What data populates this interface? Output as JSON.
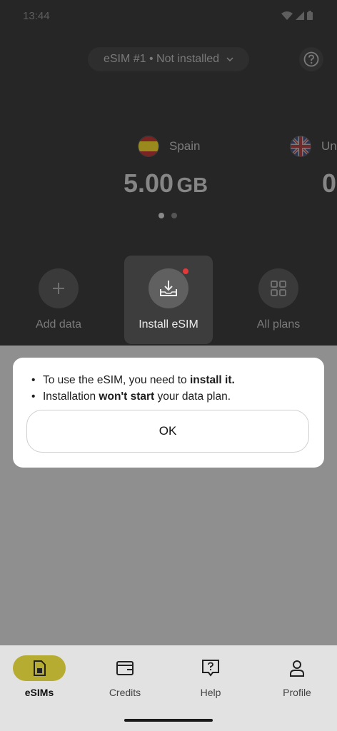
{
  "status": {
    "time": "13:44"
  },
  "header": {
    "selector_label": "eSIM #1 • Not installed",
    "help_icon": "question-circle-icon"
  },
  "carousel": {
    "cards": [
      {
        "country": "Spain",
        "data_value": "5.00",
        "data_unit": "GB"
      },
      {
        "country": "Uni",
        "data_value": "0"
      }
    ],
    "page_count": 2,
    "active_index": 0
  },
  "actions": [
    {
      "label": "Add data",
      "icon": "plus-icon"
    },
    {
      "label": "Install eSIM",
      "icon": "download-tray-icon",
      "highlighted": true
    },
    {
      "label": "All plans",
      "icon": "grid-icon"
    }
  ],
  "dialog": {
    "line1_pre": "To use the eSIM, you need to ",
    "line1_bold": "install it.",
    "line2_pre": "Installation ",
    "line2_bold": "won't start",
    "line2_post": " your data plan.",
    "ok_label": "OK"
  },
  "nav": [
    {
      "label": "eSIMs",
      "icon": "sim-card-icon",
      "active": true
    },
    {
      "label": "Credits",
      "icon": "wallet-icon"
    },
    {
      "label": "Help",
      "icon": "help-chat-icon"
    },
    {
      "label": "Profile",
      "icon": "person-icon"
    }
  ],
  "colors": {
    "accent": "#b6ac32",
    "badge": "#e5383b"
  }
}
